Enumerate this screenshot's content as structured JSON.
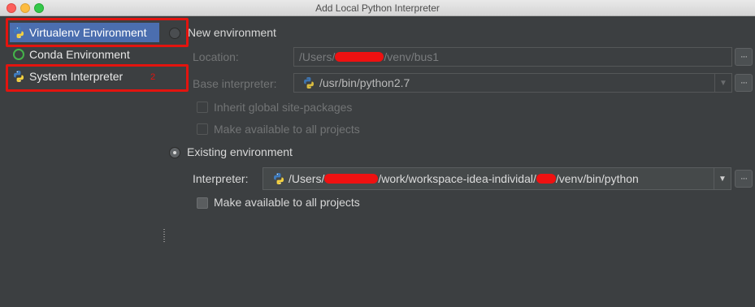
{
  "window": {
    "title": "Add Local Python Interpreter"
  },
  "sidebar": {
    "items": [
      {
        "label": "Virtualenv Environment",
        "icon": "python-icon",
        "selected": true
      },
      {
        "label": "Conda Environment",
        "icon": "conda-icon",
        "selected": false
      },
      {
        "label": "System Interpreter",
        "icon": "python-icon",
        "selected": false
      }
    ],
    "annotation_number": "2"
  },
  "new_env": {
    "radio_label": "New environment",
    "location_label": "Location:",
    "location_prefix": "/Users/",
    "location_suffix": "/venv/bus1",
    "base_label": "Base interpreter:",
    "base_value": "/usr/bin/python2.7",
    "inherit_label": "Inherit global site-packages",
    "available_label": "Make available to all projects"
  },
  "existing_env": {
    "radio_label": "Existing environment",
    "interpreter_label": "Interpreter:",
    "path_prefix": "/Users/",
    "path_middle": "/work/workspace-idea-individal/",
    "path_suffix": "/venv/bin/python",
    "available_label": "Make available to all projects"
  },
  "buttons": {
    "browse_label": "···"
  },
  "colors": {
    "selection": "#4b6eaf",
    "highlight": "#e3140f",
    "background": "#3c3f41"
  }
}
